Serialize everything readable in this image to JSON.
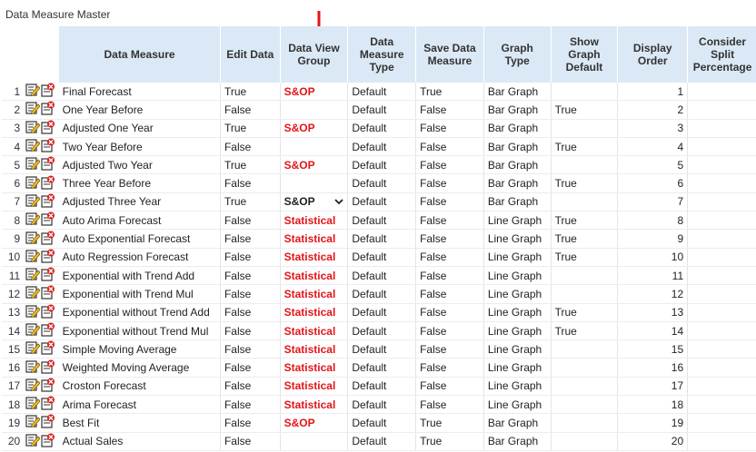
{
  "page": {
    "title": "Data Measure Master"
  },
  "columns": {
    "data_measure": "Data Measure",
    "edit_data": "Edit Data",
    "data_view_group": "Data View Group",
    "data_measure_type": "Data Measure Type",
    "save_data_measure": "Save Data Measure",
    "graph_type": "Graph Type",
    "show_graph_default": "Show Graph Default",
    "display_order": "Display Order",
    "consider_split": "Consider Split Percentage"
  },
  "rows": [
    {
      "n": "1",
      "measure": "Final Forecast",
      "edit": "True",
      "group": "S&OP",
      "type": "Default",
      "save": "True",
      "graph": "Bar Graph",
      "show": "",
      "order": "1",
      "split": ""
    },
    {
      "n": "2",
      "measure": "One Year Before",
      "edit": "False",
      "group": "",
      "type": "Default",
      "save": "False",
      "graph": "Bar Graph",
      "show": "True",
      "order": "2",
      "split": ""
    },
    {
      "n": "3",
      "measure": "Adjusted One Year",
      "edit": "True",
      "group": "S&OP",
      "type": "Default",
      "save": "False",
      "graph": "Bar Graph",
      "show": "",
      "order": "3",
      "split": ""
    },
    {
      "n": "4",
      "measure": "Two Year Before",
      "edit": "False",
      "group": "",
      "type": "Default",
      "save": "False",
      "graph": "Bar Graph",
      "show": "True",
      "order": "4",
      "split": ""
    },
    {
      "n": "5",
      "measure": "Adjusted Two Year",
      "edit": "True",
      "group": "S&OP",
      "type": "Default",
      "save": "False",
      "graph": "Bar Graph",
      "show": "",
      "order": "5",
      "split": ""
    },
    {
      "n": "6",
      "measure": "Three Year Before",
      "edit": "False",
      "group": "",
      "type": "Default",
      "save": "False",
      "graph": "Bar Graph",
      "show": "True",
      "order": "6",
      "split": ""
    },
    {
      "n": "7",
      "measure": "Adjusted Three Year",
      "edit": "True",
      "group": "S&OP",
      "type": "Default",
      "save": "False",
      "graph": "Bar Graph",
      "show": "",
      "order": "7",
      "split": ""
    },
    {
      "n": "8",
      "measure": "Auto Arima Forecast",
      "edit": "False",
      "group": "Statistical",
      "type": "Default",
      "save": "False",
      "graph": "Line Graph",
      "show": "True",
      "order": "8",
      "split": ""
    },
    {
      "n": "9",
      "measure": "Auto Exponential Forecast",
      "edit": "False",
      "group": "Statistical",
      "type": "Default",
      "save": "False",
      "graph": "Line Graph",
      "show": "True",
      "order": "9",
      "split": ""
    },
    {
      "n": "10",
      "measure": "Auto Regression Forecast",
      "edit": "False",
      "group": "Statistical",
      "type": "Default",
      "save": "False",
      "graph": "Line Graph",
      "show": "True",
      "order": "10",
      "split": ""
    },
    {
      "n": "11",
      "measure": "Exponential with Trend Add",
      "edit": "False",
      "group": "Statistical",
      "type": "Default",
      "save": "False",
      "graph": "Line Graph",
      "show": "",
      "order": "11",
      "split": ""
    },
    {
      "n": "12",
      "measure": "Exponential with Trend Mul",
      "edit": "False",
      "group": "Statistical",
      "type": "Default",
      "save": "False",
      "graph": "Line Graph",
      "show": "",
      "order": "12",
      "split": ""
    },
    {
      "n": "13",
      "measure": "Exponential without Trend Add",
      "edit": "False",
      "group": "Statistical",
      "type": "Default",
      "save": "False",
      "graph": "Line Graph",
      "show": "True",
      "order": "13",
      "split": ""
    },
    {
      "n": "14",
      "measure": "Exponential without Trend Mul",
      "edit": "False",
      "group": "Statistical",
      "type": "Default",
      "save": "False",
      "graph": "Line Graph",
      "show": "True",
      "order": "14",
      "split": ""
    },
    {
      "n": "15",
      "measure": "Simple Moving Average",
      "edit": "False",
      "group": "Statistical",
      "type": "Default",
      "save": "False",
      "graph": "Line Graph",
      "show": "",
      "order": "15",
      "split": ""
    },
    {
      "n": "16",
      "measure": "Weighted Moving Average",
      "edit": "False",
      "group": "Statistical",
      "type": "Default",
      "save": "False",
      "graph": "Line Graph",
      "show": "",
      "order": "16",
      "split": ""
    },
    {
      "n": "17",
      "measure": "Croston Forecast",
      "edit": "False",
      "group": "Statistical",
      "type": "Default",
      "save": "False",
      "graph": "Line Graph",
      "show": "",
      "order": "17",
      "split": ""
    },
    {
      "n": "18",
      "measure": "Arima Forecast",
      "edit": "False",
      "group": "Statistical",
      "type": "Default",
      "save": "False",
      "graph": "Line Graph",
      "show": "",
      "order": "18",
      "split": ""
    },
    {
      "n": "19",
      "measure": "Best Fit",
      "edit": "False",
      "group": "S&OP",
      "type": "Default",
      "save": "True",
      "graph": "Bar Graph",
      "show": "",
      "order": "19",
      "split": ""
    },
    {
      "n": "20",
      "measure": "Actual Sales",
      "edit": "False",
      "group": "",
      "type": "Default",
      "save": "True",
      "graph": "Bar Graph",
      "show": "",
      "order": "20",
      "split": ""
    }
  ],
  "editing_row_index": 6,
  "colors": {
    "header_bg": "#dbe9f6",
    "group_text": "#e3151a",
    "arrow": "#e3151a"
  },
  "icons": {
    "edit": "edit-icon",
    "delete": "delete-icon",
    "annotation": "red-down-arrow"
  }
}
